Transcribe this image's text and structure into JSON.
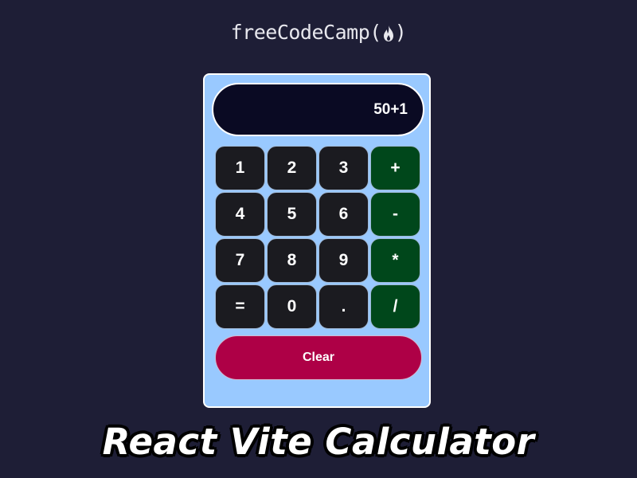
{
  "brand": {
    "name": "freeCodeCamp(",
    "close": ")"
  },
  "display": {
    "value": "50+1"
  },
  "keypad": {
    "keys": [
      "1",
      "2",
      "3",
      "+",
      "4",
      "5",
      "6",
      "-",
      "7",
      "8",
      "9",
      "*",
      "=",
      "0",
      ".",
      "/"
    ]
  },
  "clear_label": "Clear",
  "caption": "React Vite Calculator",
  "colors": {
    "background": "#1e1e36",
    "calculator_body": "#99c9ff",
    "display": "#0a0a23",
    "number_key": "#1b1b20",
    "operator_key": "#00471b",
    "clear_button": "#ae0046"
  }
}
